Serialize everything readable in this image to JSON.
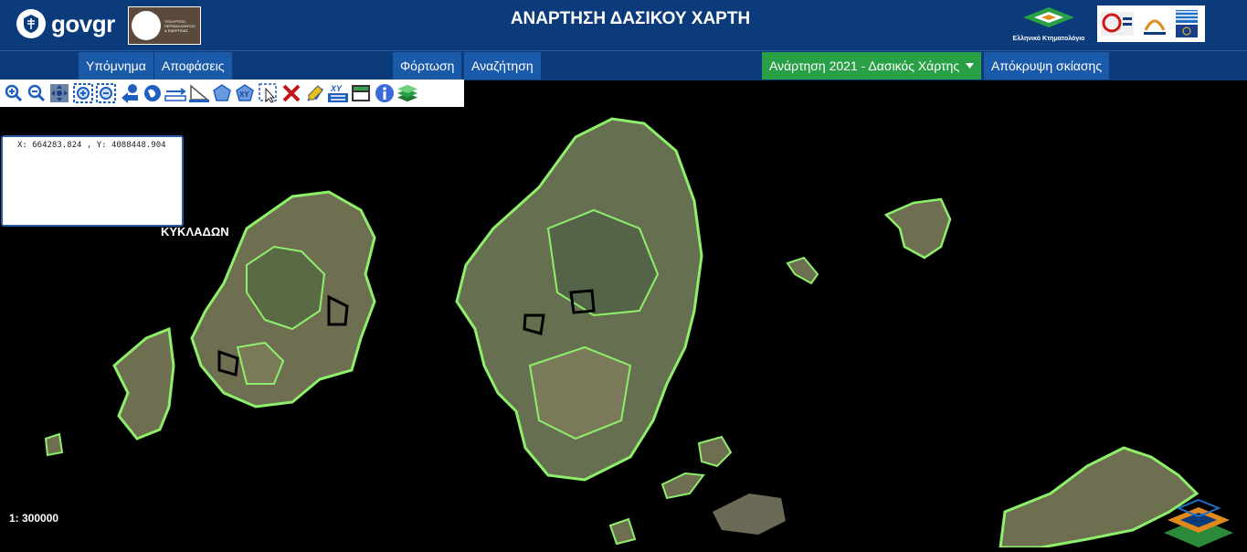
{
  "header": {
    "govgr_label": "govgr",
    "title": "ΑΝΑΡΤΗΣΗ ΔΑΣΙΚΟΥ ΧΑΡΤΗ",
    "ktima_label": "Ελληνικό Κτηματολόγιο"
  },
  "nav": {
    "legend": "Υπόμνημα",
    "decisions": "Αποφάσεις",
    "load": "Φόρτωση",
    "search": "Αναζήτηση",
    "posting_select": "Ανάρτηση 2021 - Δασικός Χάρτης",
    "hide_shading": "Απόκρυψη σκίασης"
  },
  "toolbar": {
    "icons": [
      "zoom-in-icon",
      "zoom-out-icon",
      "pan-icon",
      "zoom-box-in-icon",
      "zoom-box-out-icon",
      "previous-extent-icon",
      "full-extent-icon",
      "measure-distance-icon",
      "measure-angle-icon",
      "measure-area-icon",
      "xy-polygon-icon",
      "select-icon",
      "clear-icon",
      "edit-icon",
      "xy-goto-icon",
      "print-icon",
      "info-icon",
      "layers-icon"
    ],
    "xy_label": "XY"
  },
  "map": {
    "coords": "X: 664283.824 , Y: 4088448.904",
    "region_label": "ΚΥΚΛΑΔΩΝ",
    "scale": "1: 300000"
  },
  "colors": {
    "header_bg": "#0c3b7c",
    "nav_button": "#1a5aa8",
    "accent_green": "#2aa046",
    "forest_outline": "#8ef06a"
  }
}
